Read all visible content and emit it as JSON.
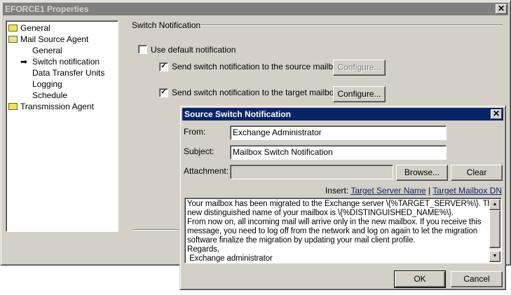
{
  "main_window": {
    "title": "EFORCE1 Properties",
    "tree": [
      {
        "label": "General",
        "icon": "folder-icon"
      },
      {
        "label": "Mail Source Agent",
        "icon": "folder-open-icon"
      },
      {
        "label": "General"
      },
      {
        "label": "Switch notification",
        "selected": true,
        "icon": "arrow-icon"
      },
      {
        "label": "Data Transfer Units"
      },
      {
        "label": "Logging"
      },
      {
        "label": "Schedule"
      },
      {
        "label": "Transmission Agent",
        "icon": "folder-icon"
      }
    ],
    "section_title": "Switch Notification",
    "use_default": {
      "label": "Use default notification",
      "checked": false
    },
    "source_mailbox": {
      "label": "Send switch notification to the source mailbox",
      "checked": true,
      "button": "Configure..."
    },
    "target_mailbox": {
      "label": "Send switch notification to the target mailbox",
      "checked": true,
      "button": "Configure..."
    }
  },
  "dialog": {
    "title": "Source Switch Notification",
    "from_label": "From:",
    "from_value": "Exchange Administrator",
    "subject_label": "Subject:",
    "subject_value": "Mailbox Switch Notification",
    "attachment_label": "Attachment:",
    "attachment_value": "",
    "browse": "Browse...",
    "clear": "Clear",
    "insert_label": "Insert:",
    "insert_server": "Target Server Name",
    "insert_sep": "|",
    "insert_dn": "Target Mailbox DN",
    "body": "Your mailbox has been migrated to the Exchange server \\{%TARGET_SERVER%\\}. The\nnew distinguished name of your mailbox is \\{%DISTINGUISHED_NAME%\\}.\nFrom now on, all incoming mail will arrive only in the new mailbox. If you receive this\nmessage, you need to log off from the network and log on again to let the migration\nsoftware finalize the migration by updating your mail client profile.\nRegards,\n Exchange administrator",
    "ok": "OK",
    "cancel": "Cancel"
  }
}
